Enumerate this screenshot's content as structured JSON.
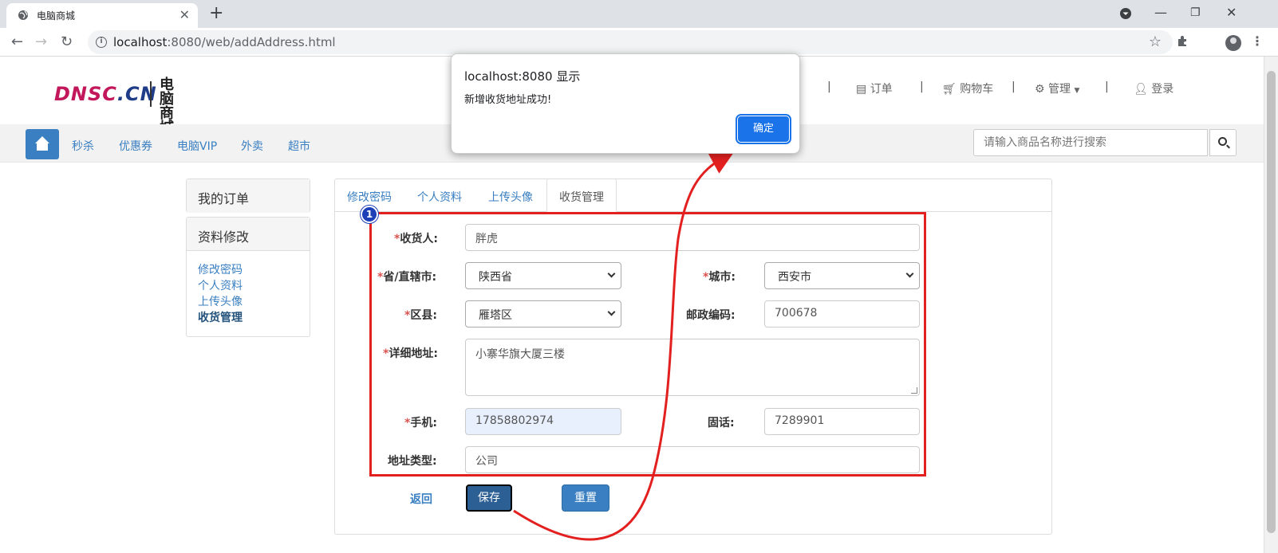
{
  "browser": {
    "tab_title": "电脑商城",
    "url_host": "localhost",
    "url_path": ":8080/web/addAddress.html"
  },
  "site": {
    "logo_en_main": "DNSC",
    "logo_en_suffix": ".CN",
    "logo_cn_line1": "电脑",
    "logo_cn_line2": "商城",
    "topnav": {
      "orders": "订单",
      "cart": "购物车",
      "manage": "管理",
      "login": "登录"
    },
    "categories": [
      "秒杀",
      "优惠券",
      "电脑VIP",
      "外卖",
      "超市"
    ],
    "search_placeholder": "请输入商品名称进行搜索"
  },
  "sidebar": {
    "my_orders": "我的订单",
    "profile_edit": "资料修改",
    "links": [
      "修改密码",
      "个人资料",
      "上传头像",
      "收货管理"
    ]
  },
  "panel": {
    "tabs": [
      "修改密码",
      "个人资料",
      "上传头像",
      "收货管理"
    ],
    "form": {
      "receiver_label": "收货人:",
      "receiver_value": "胖虎",
      "province_label": "省/直辖市:",
      "province_value": "陕西省",
      "city_label": "城市:",
      "city_value": "西安市",
      "district_label": "区县:",
      "district_value": "雁塔区",
      "zip_label": "邮政编码:",
      "zip_value": "700678",
      "address_label": "详细地址:",
      "address_value": "小寨华旗大厦三楼",
      "phone_label": "手机:",
      "phone_value": "17858802974",
      "tel_label": "固话:",
      "tel_value": "7289901",
      "type_label": "地址类型:",
      "type_value": "公司",
      "back": "返回",
      "save": "保存",
      "reset": "重置"
    },
    "step_badge": "1"
  },
  "dialog": {
    "title": "localhost:8080 显示",
    "message": "新增收货地址成功!",
    "ok": "确定"
  },
  "colors": {
    "accent": "#3a7fc1",
    "annotation_red": "#e32020",
    "badge_blue": "#1d3fb8",
    "dialog_button": "#1a73e8"
  }
}
